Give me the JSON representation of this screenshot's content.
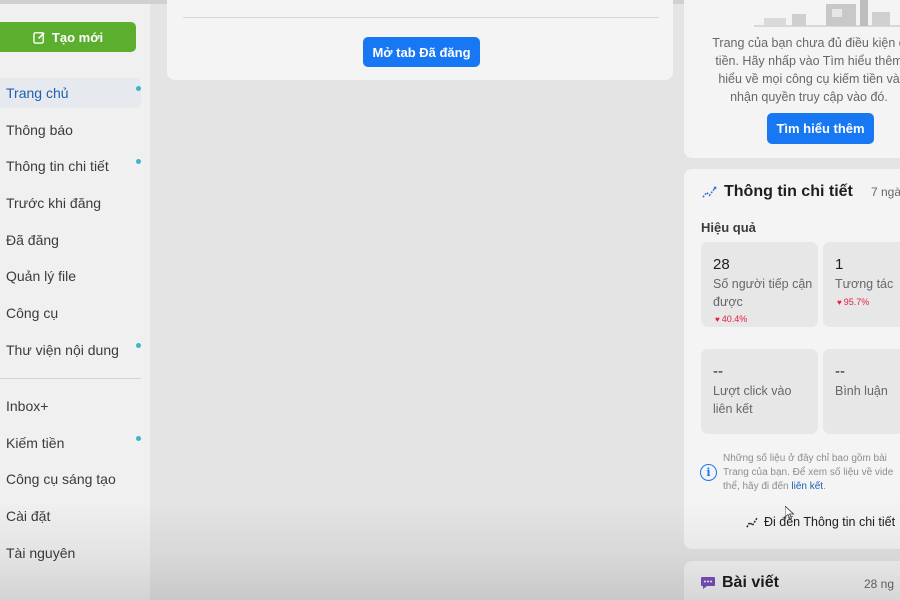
{
  "sidebar": {
    "create_label": "Tạo mới",
    "items": [
      {
        "label": "Trang chủ",
        "active": true,
        "dot": true
      },
      {
        "label": "Thông báo",
        "active": false,
        "dot": false
      },
      {
        "label": "Thông tin chi tiết",
        "active": false,
        "dot": true
      },
      {
        "label": "Trước khi đăng",
        "active": false,
        "dot": false
      },
      {
        "label": "Đã đăng",
        "active": false,
        "dot": false
      },
      {
        "label": "Quản lý file",
        "active": false,
        "dot": false
      },
      {
        "label": "Công cụ",
        "active": false,
        "dot": false
      },
      {
        "label": "Thư viện nội dung",
        "active": false,
        "dot": true
      }
    ],
    "items2": [
      {
        "label": "Inbox+",
        "dot": false
      },
      {
        "label": "Kiếm tiền",
        "dot": true
      },
      {
        "label": "Công cụ sáng tạo",
        "dot": false
      },
      {
        "label": "Cài đặt",
        "dot": false
      },
      {
        "label": "Tài nguyên",
        "dot": false
      }
    ]
  },
  "main": {
    "open_tab_label": "Mở tab Đã đăng"
  },
  "eligibility": {
    "lines": [
      "Trang của bạn chưa đủ điều kiện đ",
      "tiền. Hãy nhấp vào Tìm hiểu thêm",
      "hiểu về mọi công cụ kiếm tiền và",
      "nhận quyền truy cập vào đó."
    ],
    "learn_more_label": "Tìm hiểu thêm"
  },
  "insights": {
    "title": "Thông tin chi tiết",
    "range": "7 ngà",
    "subtitle": "Hiệu quả",
    "metrics": [
      {
        "value": "28",
        "label": "Số người tiếp cận được",
        "change": "40.4%"
      },
      {
        "value": "1",
        "label": "Tương tác",
        "change": "95.7%"
      },
      {
        "value": "--",
        "label": "Lượt click vào liên kết",
        "change": ""
      },
      {
        "value": "--",
        "label": "Bình luận",
        "change": ""
      }
    ],
    "note_lines": [
      "Những số liệu ở đây chỉ bao gồm bài",
      "Trang của bạn. Để xem số liệu về vide",
      "thể, hãy đi đến"
    ],
    "note_link": "liên kết",
    "goto_label": "Đi đến Thông tin chi tiết"
  },
  "posts": {
    "title": "Bài viết",
    "date": "28 ng"
  },
  "colors": {
    "accent": "#1877f2",
    "create": "#5cae2e",
    "active_text": "#1d5fb0",
    "dot": "#3fb5c9",
    "decline": "#e41e3f"
  }
}
